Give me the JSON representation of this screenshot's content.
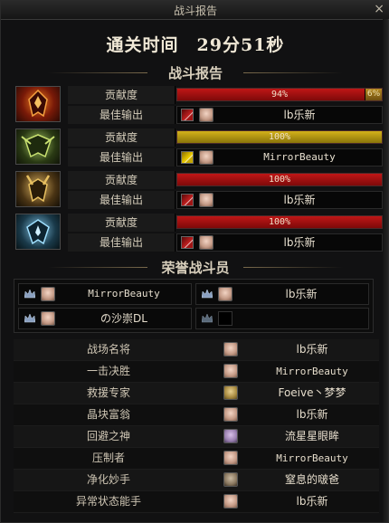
{
  "window": {
    "title": "战斗报告",
    "close": "×"
  },
  "clear_time": "通关时间　29分51秒",
  "sections": {
    "report": "战斗报告",
    "honor": "荣誉战斗员"
  },
  "labels": {
    "contribution": "贡献度",
    "best_output": "最佳输出"
  },
  "heroes": [
    {
      "portrait_icon": "red-flame-mask-icon",
      "contribution_text": "94%",
      "contribution": 0.94,
      "extra_text": "6%",
      "bar_color": "#c01616",
      "skill_icon": "red-slash-skill-icon",
      "best_output": "lb乐新"
    },
    {
      "portrait_icon": "green-winged-mask-icon",
      "contribution_text": "100%",
      "contribution": 1.0,
      "bar_color": "#d4b21a",
      "skill_icon": "yellow-slash-skill-icon",
      "best_output": "MirrorBeauty"
    },
    {
      "portrait_icon": "gold-horned-mask-icon",
      "contribution_text": "100%",
      "contribution": 1.0,
      "bar_color": "#c01616",
      "skill_icon": "red-slash-skill-icon",
      "best_output": "lb乐新"
    },
    {
      "portrait_icon": "blue-ice-mask-icon",
      "contribution_text": "100%",
      "contribution": 1.0,
      "bar_color": "#c01616",
      "skill_icon": "red-slash-skill-icon",
      "best_output": "lb乐新"
    }
  ],
  "honor": [
    {
      "name": "MirrorBeauty"
    },
    {
      "name": "lb乐新"
    },
    {
      "name": "の沙崇DL"
    },
    {
      "name": ""
    }
  ],
  "stats": [
    {
      "title": "战场名将",
      "name": "lb乐新"
    },
    {
      "title": "一击决胜",
      "name": "MirrorBeauty"
    },
    {
      "title": "救援专家",
      "name": "Foeive丶梦梦"
    },
    {
      "title": "晶块富翁",
      "name": "lb乐新"
    },
    {
      "title": "回避之神",
      "name": "流星星眼眸"
    },
    {
      "title": "压制者",
      "name": "MirrorBeauty"
    },
    {
      "title": "净化妙手",
      "name": "窒息的啵爸"
    },
    {
      "title": "异常状态能手",
      "name": "lb乐新"
    }
  ]
}
